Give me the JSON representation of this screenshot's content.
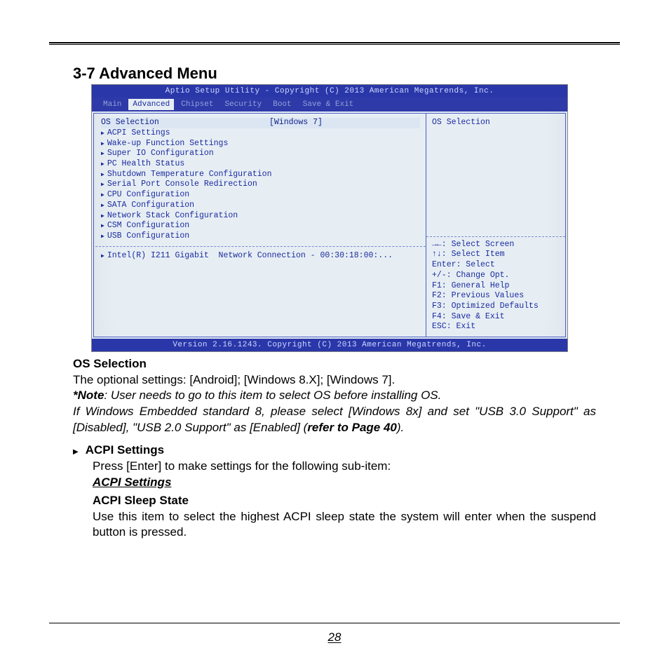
{
  "heading": "3-7 Advanced Menu",
  "bios": {
    "topbar": "Aptio Setup Utility - Copyright (C) 2013 American Megatrends, Inc.",
    "tabs": [
      "Main",
      "Advanced",
      "Chipset",
      "Security",
      "Boot",
      "Save & Exit"
    ],
    "active_tab_index": 1,
    "selected_item": {
      "label": "OS Selection",
      "value": "[Windows 7]"
    },
    "items": [
      "ACPI Settings",
      "Wake-up Function Settings",
      "Super IO Configuration",
      "PC Health Status",
      "Shutdown Temperature Configuration",
      "Serial Port Console Redirection",
      "CPU Configuration",
      "SATA Configuration",
      "Network Stack Configuration",
      "CSM Configuration",
      "USB Configuration"
    ],
    "extra_item": "Intel(R) I211 Gigabit  Network Connection - 00:30:18:00:...",
    "help_title": "OS Selection",
    "help_keys": [
      "→←: Select Screen",
      "↑↓: Select Item",
      "Enter: Select",
      "+/-: Change Opt.",
      "F1: General Help",
      "F2: Previous Values",
      "F3: Optimized Defaults",
      "F4: Save & Exit",
      "ESC: Exit"
    ],
    "bottombar": "Version 2.16.1243. Copyright (C) 2013 American Megatrends, Inc."
  },
  "doc": {
    "os_heading": "OS Selection",
    "os_line": "The optional settings: [Android]; [Windows 8.X]; [Windows 7].",
    "note_lead": "*Note",
    "note_rest": ": User needs to go to this item to select OS before installing OS.",
    "note_para_a": " If Windows Embedded standard 8, please select [Windows 8x] and set \"USB 3.0 Support\" as [Disabled], \"USB 2.0 Support\" as [Enabled] (",
    "note_para_b": "refer to Page 40",
    "note_para_c": ").",
    "acpi_bullet": "ACPI Settings",
    "acpi_enter": "Press [Enter] to make settings for the following sub-item:",
    "acpi_sub": "ACPI Settings",
    "sleep_heading": "ACPI Sleep State",
    "sleep_text": "Use this item to select the highest ACPI sleep state the system will enter when the suspend button is pressed."
  },
  "page_number": "28"
}
